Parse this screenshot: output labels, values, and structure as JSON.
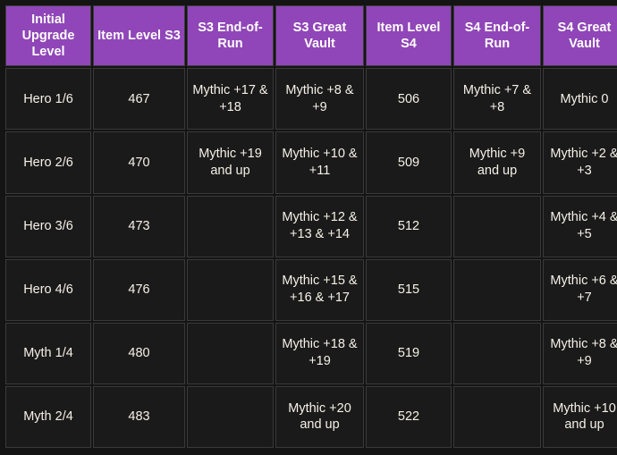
{
  "table": {
    "headers": [
      "Initial Upgrade Level",
      "Item Level S3",
      "S3 End-of-Run",
      "S3 Great Vault",
      "Item Level S4",
      "S4 End-of-Run",
      "S4 Great Vault"
    ],
    "rows": [
      {
        "initial_upgrade_level": "Hero 1/6",
        "item_level_s3": "467",
        "s3_end_of_run": "Mythic +17 & +18",
        "s3_great_vault": "Mythic +8 & +9",
        "item_level_s4": "506",
        "s4_end_of_run": "Mythic +7 & +8",
        "s4_great_vault": "Mythic 0"
      },
      {
        "initial_upgrade_level": "Hero 2/6",
        "item_level_s3": "470",
        "s3_end_of_run": "Mythic +19 and up",
        "s3_great_vault": "Mythic +10 & +11",
        "item_level_s4": "509",
        "s4_end_of_run": "Mythic +9 and up",
        "s4_great_vault": "Mythic +2 & +3"
      },
      {
        "initial_upgrade_level": "Hero 3/6",
        "item_level_s3": "473",
        "s3_end_of_run": "",
        "s3_great_vault": "Mythic +12 & +13 & +14",
        "item_level_s4": "512",
        "s4_end_of_run": "",
        "s4_great_vault": "Mythic +4 & +5"
      },
      {
        "initial_upgrade_level": "Hero 4/6",
        "item_level_s3": "476",
        "s3_end_of_run": "",
        "s3_great_vault": "Mythic +15 & +16 & +17",
        "item_level_s4": "515",
        "s4_end_of_run": "",
        "s4_great_vault": "Mythic +6 & +7"
      },
      {
        "initial_upgrade_level": "Myth 1/4",
        "item_level_s3": "480",
        "s3_end_of_run": "",
        "s3_great_vault": "Mythic +18 & +19",
        "item_level_s4": "519",
        "s4_end_of_run": "",
        "s4_great_vault": "Mythic +8 & +9"
      },
      {
        "initial_upgrade_level": "Myth 2/4",
        "item_level_s3": "483",
        "s3_end_of_run": "",
        "s3_great_vault": "Mythic +20 and up",
        "item_level_s4": "522",
        "s4_end_of_run": "",
        "s4_great_vault": "Mythic +10 and up"
      }
    ]
  },
  "colors": {
    "header_background": "#9046b8",
    "header_text": "#ffffff",
    "cell_background": "#1a1a1a",
    "cell_text": "#f5f1e8",
    "border": "#3a3a3a",
    "page_background": "#141414"
  }
}
